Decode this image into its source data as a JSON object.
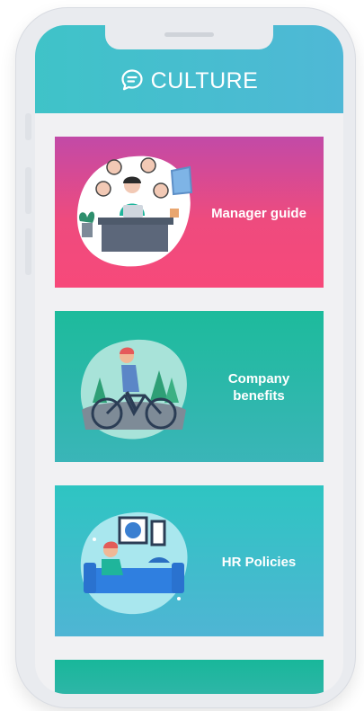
{
  "header": {
    "title": "CULTURE",
    "icon": "chat-bubble-icon"
  },
  "colors": {
    "header": "#46bfd0",
    "screen_bg": "#f1f1f3",
    "label": "#ffffff"
  },
  "cards": [
    {
      "label": "Manager guide",
      "illustration": "manager-at-desk-illustration"
    },
    {
      "label": "Company benefits",
      "illustration": "person-on-bicycle-illustration"
    },
    {
      "label": "HR Policies",
      "illustration": "person-on-sofa-illustration"
    }
  ]
}
